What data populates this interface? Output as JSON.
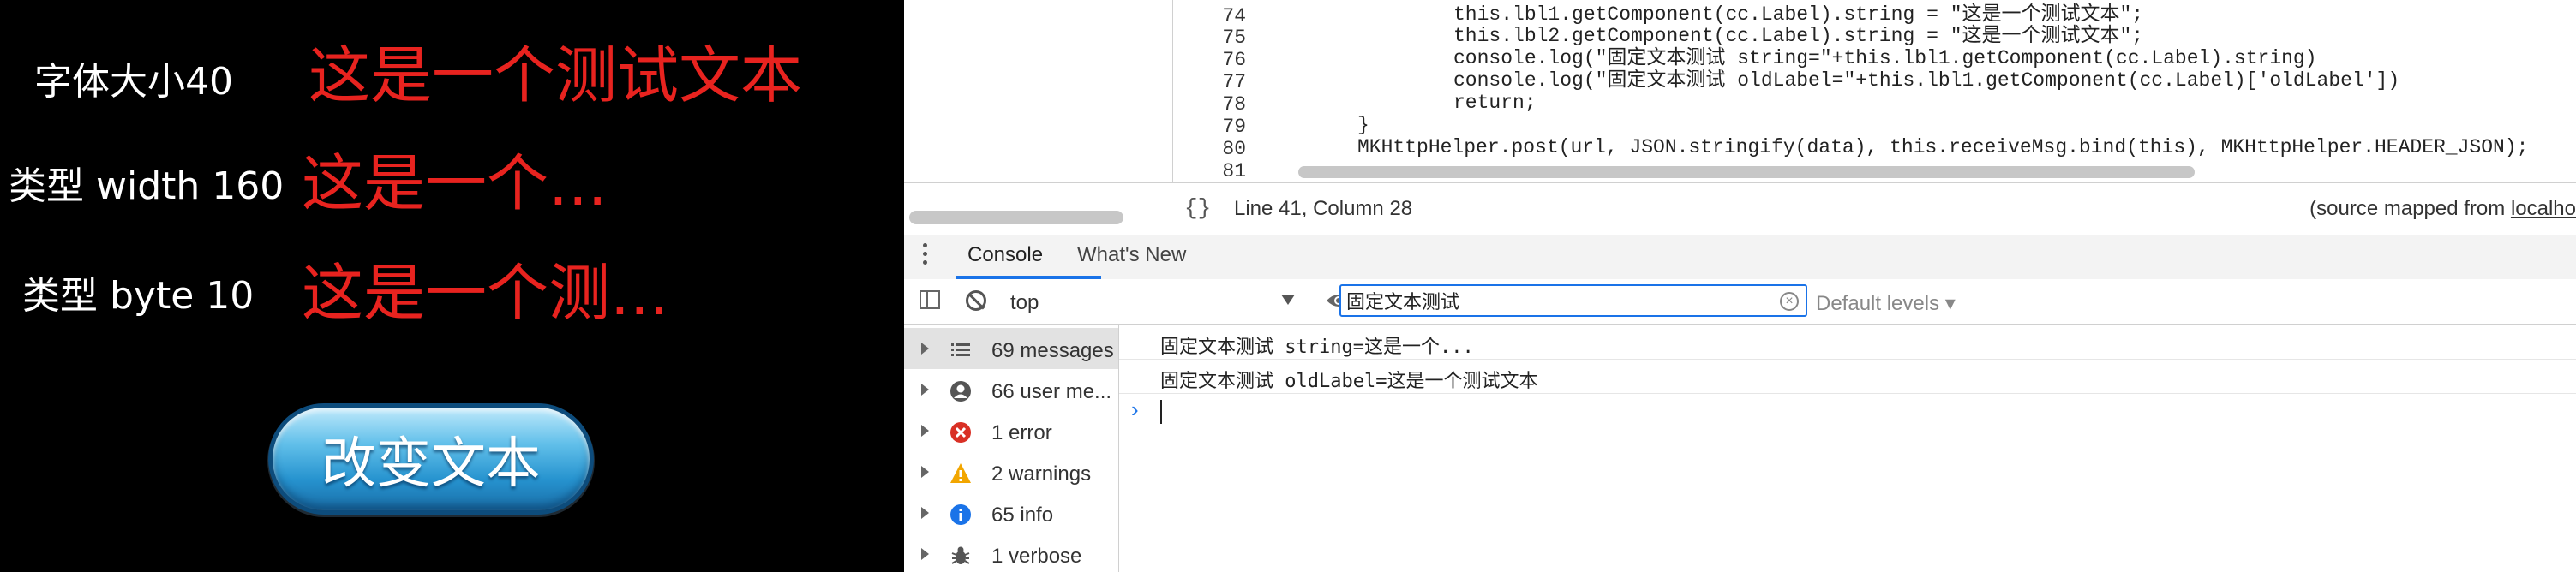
{
  "game": {
    "rows": [
      {
        "label": "字体大小40",
        "text": "这是一个测试文本"
      },
      {
        "label": "类型 width 160",
        "text": "这是一个..."
      },
      {
        "label": "类型 byte 10",
        "text": "这是一个测..."
      }
    ],
    "button_label": "改变文本"
  },
  "source": {
    "lines": [
      {
        "num": "74",
        "code": "this.lbl1.getComponent(cc.Label).string = \"这是一个测试文本\";"
      },
      {
        "num": "75",
        "code": "this.lbl2.getComponent(cc.Label).string = \"这是一个测试文本\";"
      },
      {
        "num": "76",
        "code": "console.log(\"固定文本测试 string=\"+this.lbl1.getComponent(cc.Label).string)"
      },
      {
        "num": "77",
        "code": "console.log(\"固定文本测试 oldLabel=\"+this.lbl1.getComponent(cc.Label)['oldLabel'])"
      },
      {
        "num": "78",
        "code": "return;"
      },
      {
        "num": "79",
        "code": "}"
      },
      {
        "num": "80",
        "code": "MKHttpHelper.post(url, JSON.stringify(data), this.receiveMsg.bind(this), MKHttpHelper.HEADER_JSON);"
      },
      {
        "num": "81",
        "code": ""
      }
    ]
  },
  "status": {
    "braces": "{}",
    "position": "Line 41, Column 28",
    "source_mapped_prefix": "(source mapped from ",
    "source_mapped_link": "localho"
  },
  "drawer": {
    "tabs": [
      "Console",
      "What's New"
    ]
  },
  "toolbar": {
    "context": "top",
    "filter_value": "固定文本测试",
    "levels": "Default levels ▾"
  },
  "sidebar": {
    "items": [
      {
        "icon": "list-icon",
        "label": "69 messages"
      },
      {
        "icon": "user-icon",
        "label": "66 user me..."
      },
      {
        "icon": "error-icon",
        "label": "1 error"
      },
      {
        "icon": "warning-icon",
        "label": "2 warnings"
      },
      {
        "icon": "info-icon",
        "label": "65 info"
      },
      {
        "icon": "bug-icon",
        "label": "1 verbose"
      }
    ]
  },
  "console": {
    "lines": [
      "固定文本测试 string=这是一个...",
      "固定文本测试 oldLabel=这是一个测试文本"
    ],
    "prompt": "›"
  },
  "colors": {
    "game_text": "#e8231f",
    "accent": "#1a73e8",
    "error": "#d93025",
    "warning": "#f2a600",
    "info": "#1a73e8"
  }
}
